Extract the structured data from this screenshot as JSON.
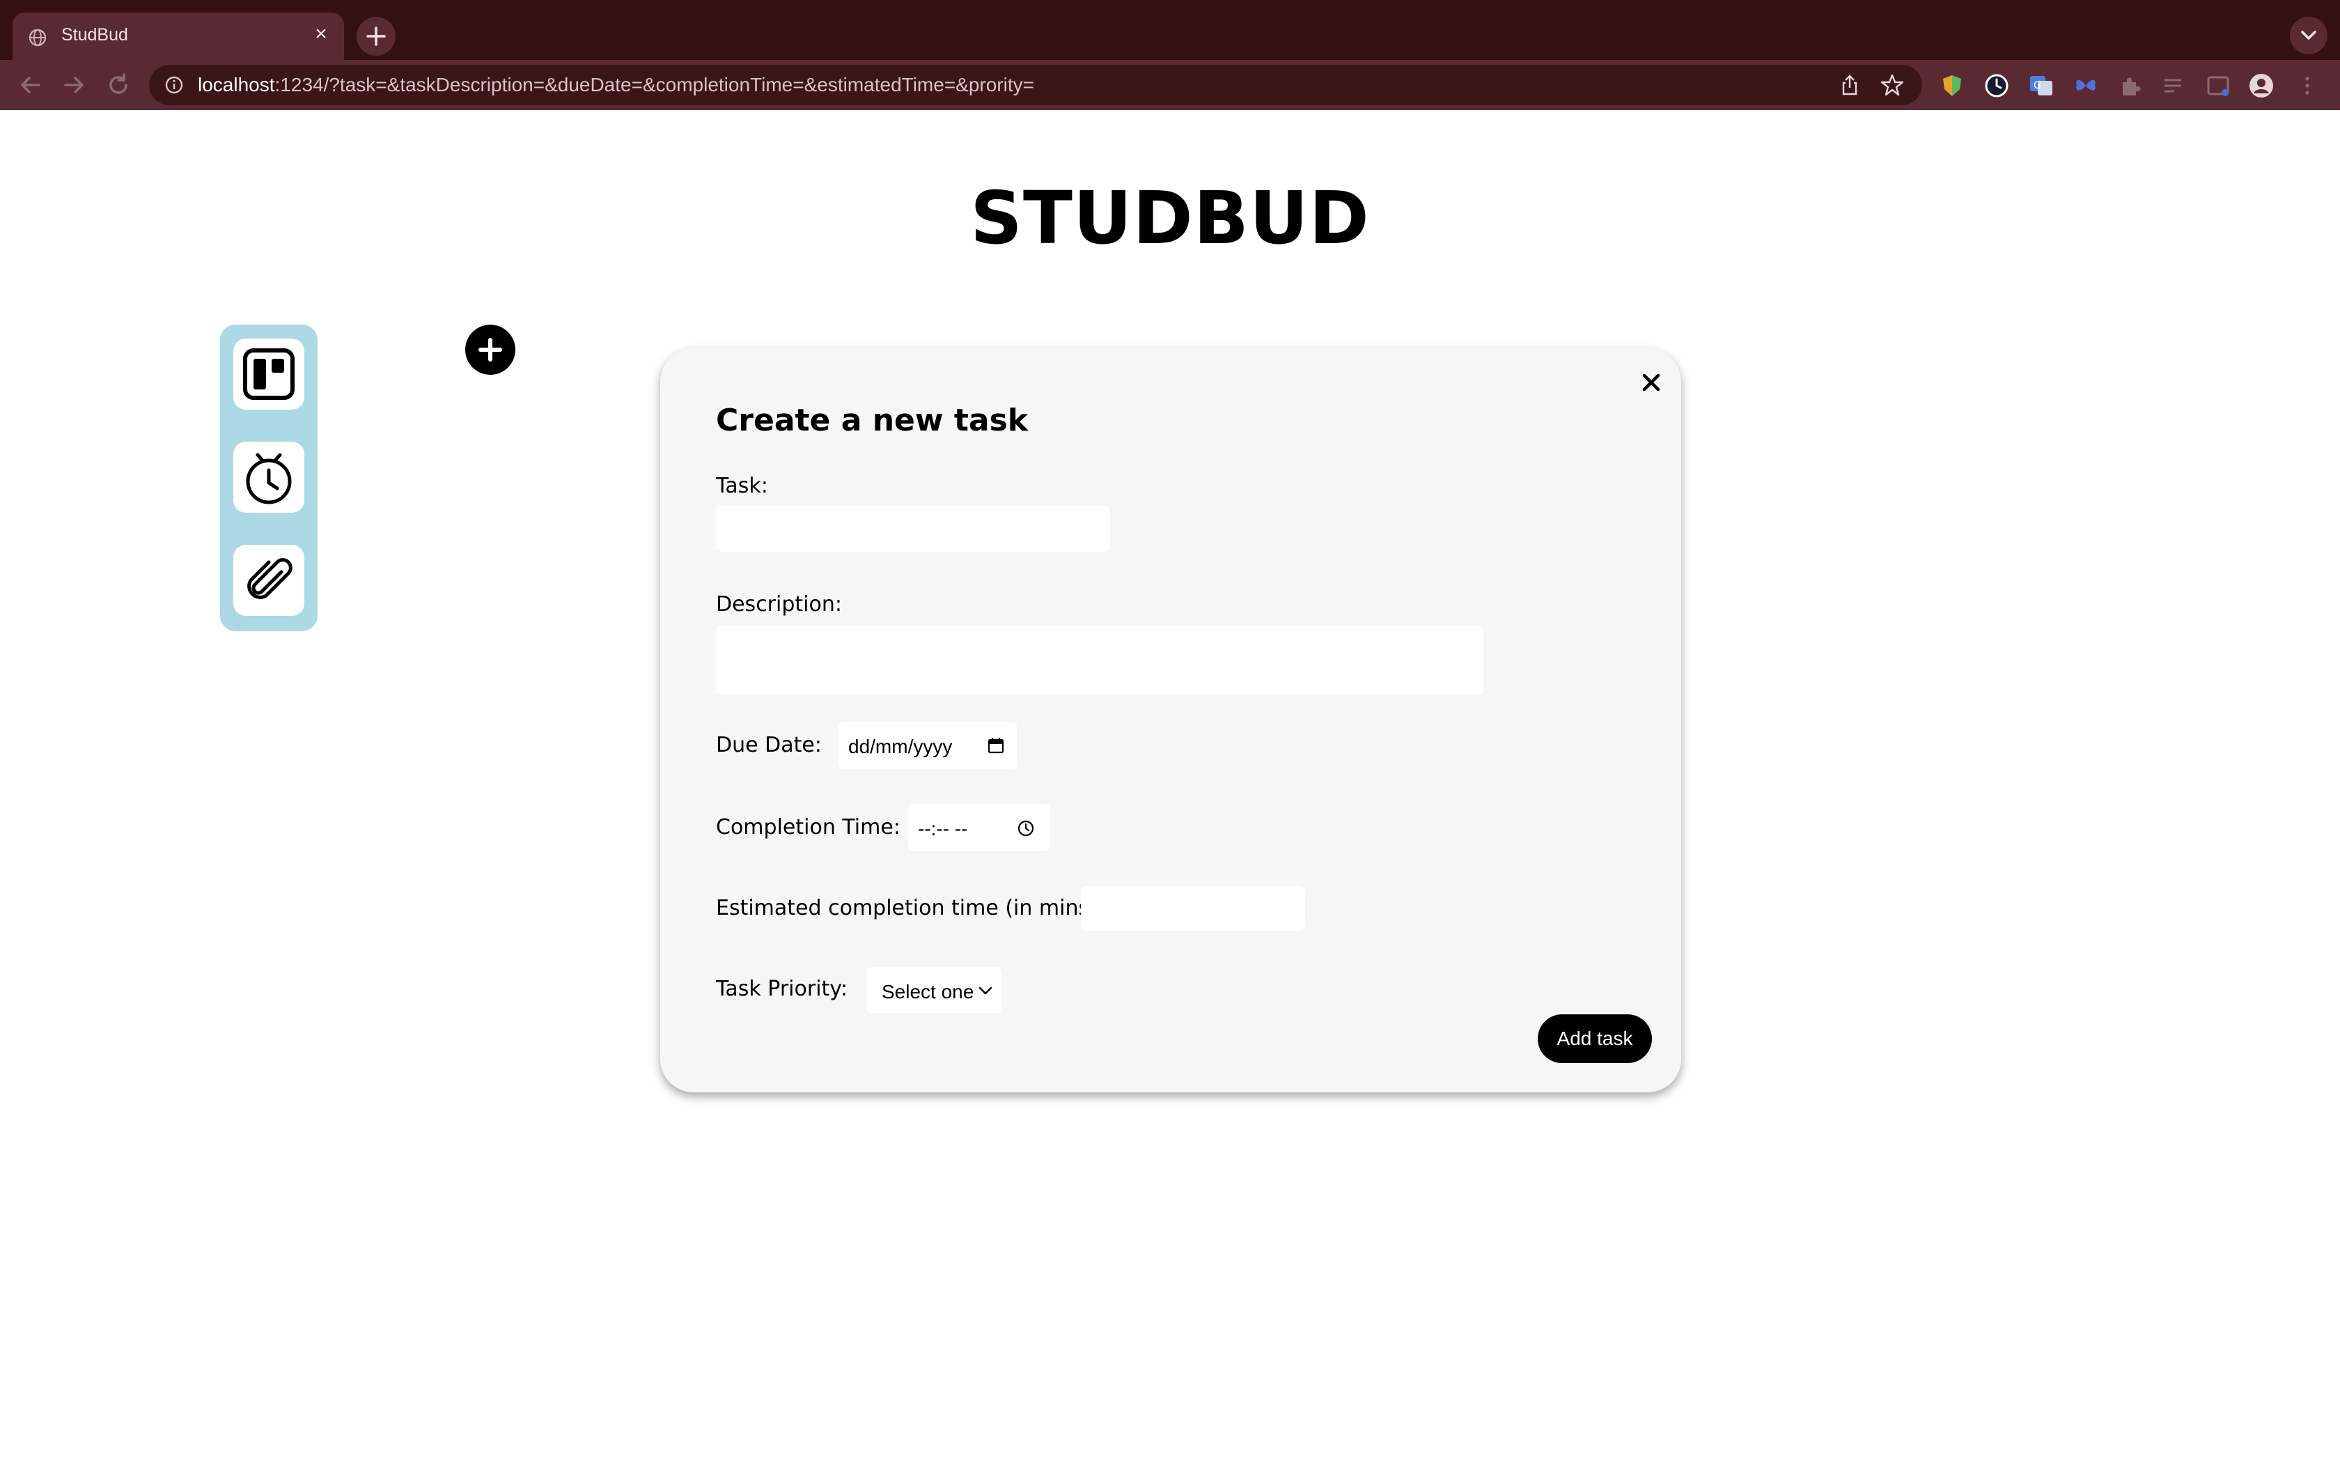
{
  "browser": {
    "tab": {
      "title": "StudBud",
      "close_glyph": "×"
    },
    "address": {
      "host": "localhost",
      "path": ":1234/?task=&taskDescription=&dueDate=&completionTime=&estimatedTime=&prority="
    },
    "icons": {
      "tab_favicon": "globe-icon",
      "new_tab": "plus-icon",
      "tab_search": "chevron-down-icon",
      "back": "arrow-left-icon",
      "forward": "arrow-right-icon",
      "reload": "reload-icon",
      "site_info": "info-icon",
      "share": "share-icon",
      "bookmark": "star-icon",
      "extensions": [
        "brave-shield-icon",
        "clock-extension-icon",
        "translate-icon",
        "butterfly-extension-icon",
        "puzzle-icon",
        "reading-list-icon",
        "sidepanel-icon",
        "profile-icon",
        "kebab-menu-icon"
      ]
    }
  },
  "page": {
    "title": "STUDBUD",
    "sidebar": {
      "items": [
        {
          "name": "kanban-board",
          "icon": "kanban-icon"
        },
        {
          "name": "timer",
          "icon": "stopwatch-icon"
        },
        {
          "name": "resources",
          "icon": "paperclip-icon"
        }
      ]
    },
    "add_button_icon": "plus-icon"
  },
  "modal": {
    "heading": "Create a new task",
    "close_icon": "close-icon",
    "task_label": "Task:",
    "task_value": "",
    "description_label": "Description:",
    "description_value": "",
    "due_date_label": "Due Date:",
    "due_date_placeholder": "dd/mm/yyyy",
    "completion_time_label": "Completion Time:",
    "completion_time_placeholder": "--:-- --",
    "estimated_label": "Estimated completion time (in mins):",
    "estimated_value": "",
    "priority_label": "Task Priority:",
    "priority_selected": "Select one",
    "submit_label": "Add task"
  },
  "colors": {
    "tabstrip": "#351012",
    "toolbar": "#5a2a33",
    "sidebar": "#add8e6",
    "modal_bg": "#f6f6f6",
    "primary_button": "#000000"
  }
}
